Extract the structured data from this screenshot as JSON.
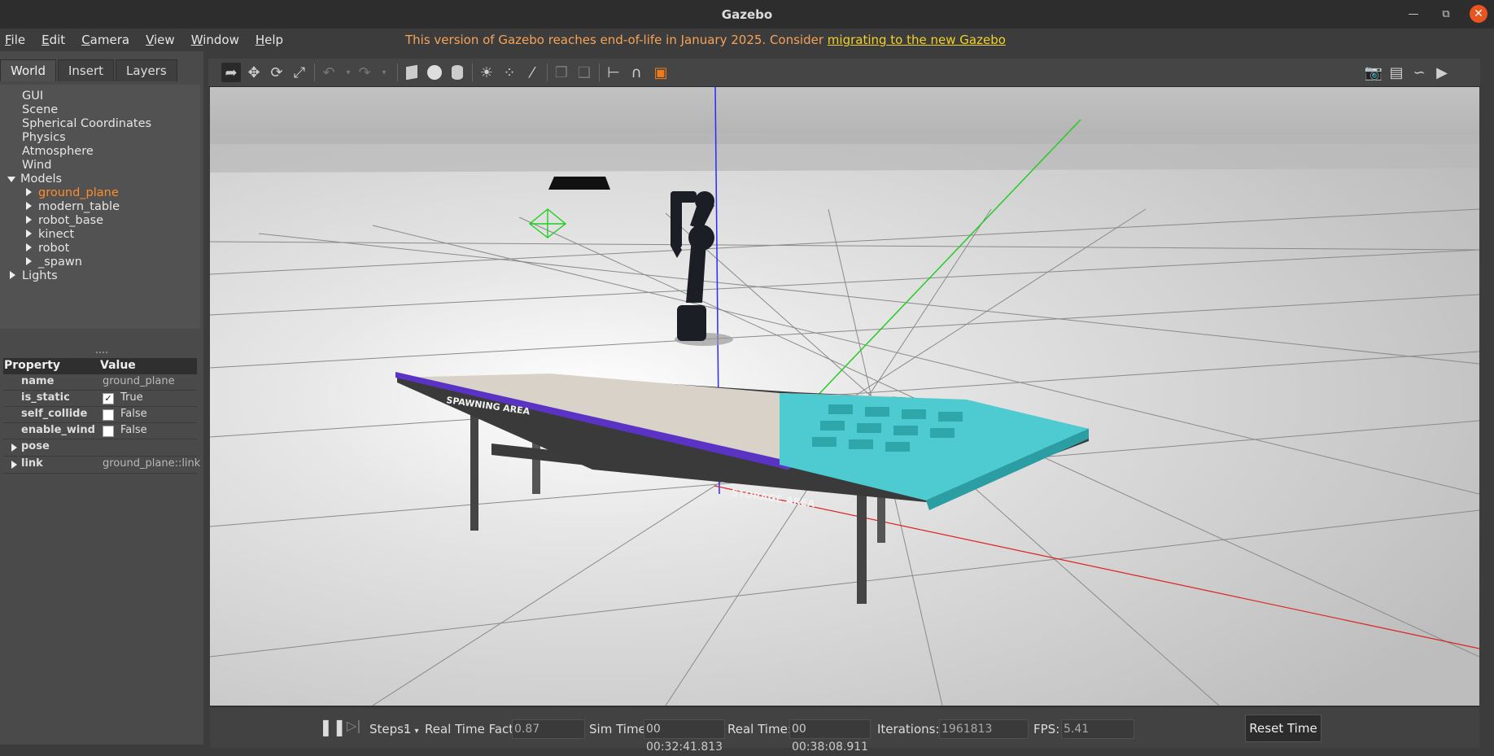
{
  "window": {
    "title": "Gazebo"
  },
  "menu": [
    {
      "underline": "F",
      "rest": "ile"
    },
    {
      "underline": "E",
      "rest": "dit"
    },
    {
      "underline": "C",
      "rest": "amera"
    },
    {
      "underline": "V",
      "rest": "iew"
    },
    {
      "underline": "W",
      "rest": "indow"
    },
    {
      "underline": "H",
      "rest": "elp"
    }
  ],
  "eol_notice": {
    "text": "This version of Gazebo reaches end-of-life in January 2025. Consider ",
    "link": "migrating to the new Gazebo"
  },
  "tabs": [
    "World",
    "Insert",
    "Layers"
  ],
  "tree": {
    "items": [
      "GUI",
      "Scene",
      "Spherical Coordinates",
      "Physics",
      "Atmosphere",
      "Wind",
      "Models"
    ],
    "models": [
      "ground_plane",
      "modern_table",
      "robot_base",
      "kinect",
      "robot",
      "_spawn"
    ],
    "lights": "Lights"
  },
  "properties": {
    "header": {
      "property": "Property",
      "value": "Value"
    },
    "name": {
      "key": "name",
      "value": "ground_plane"
    },
    "is_static": {
      "key": "is_static",
      "value": "True",
      "checked": true
    },
    "self_collide": {
      "key": "self_collide",
      "value": "False",
      "checked": false
    },
    "enable_wind": {
      "key": "enable_wind",
      "value": "False",
      "checked": false
    },
    "pose": {
      "key": "pose"
    },
    "link": {
      "key": "link",
      "value": "ground_plane::link"
    }
  },
  "scene": {
    "table_left_label": "SPAWNING AREA",
    "table_right_label": "STORAGE AREA"
  },
  "bottom": {
    "steps_label": "Steps:",
    "steps_value": "1",
    "rtf_label": "Real Time Factor:",
    "rtf_value": "0.87",
    "sim_label": "Sim Time:",
    "sim_value": "00 00:32:41.813",
    "real_label": "Real Time:",
    "real_value": "00 00:38:08.911",
    "iter_label": "Iterations:",
    "iter_value": "1961813",
    "fps_label": "FPS:",
    "fps_value": "5.41",
    "reset_label": "Reset Time"
  },
  "colors": {
    "selected": "#ff8c2a",
    "eol_text": "#f5a35a",
    "eol_link": "#f1d12e",
    "table_teal": "#4ecbd0",
    "table_purple": "#5b33c4",
    "close_btn": "#e95420"
  }
}
